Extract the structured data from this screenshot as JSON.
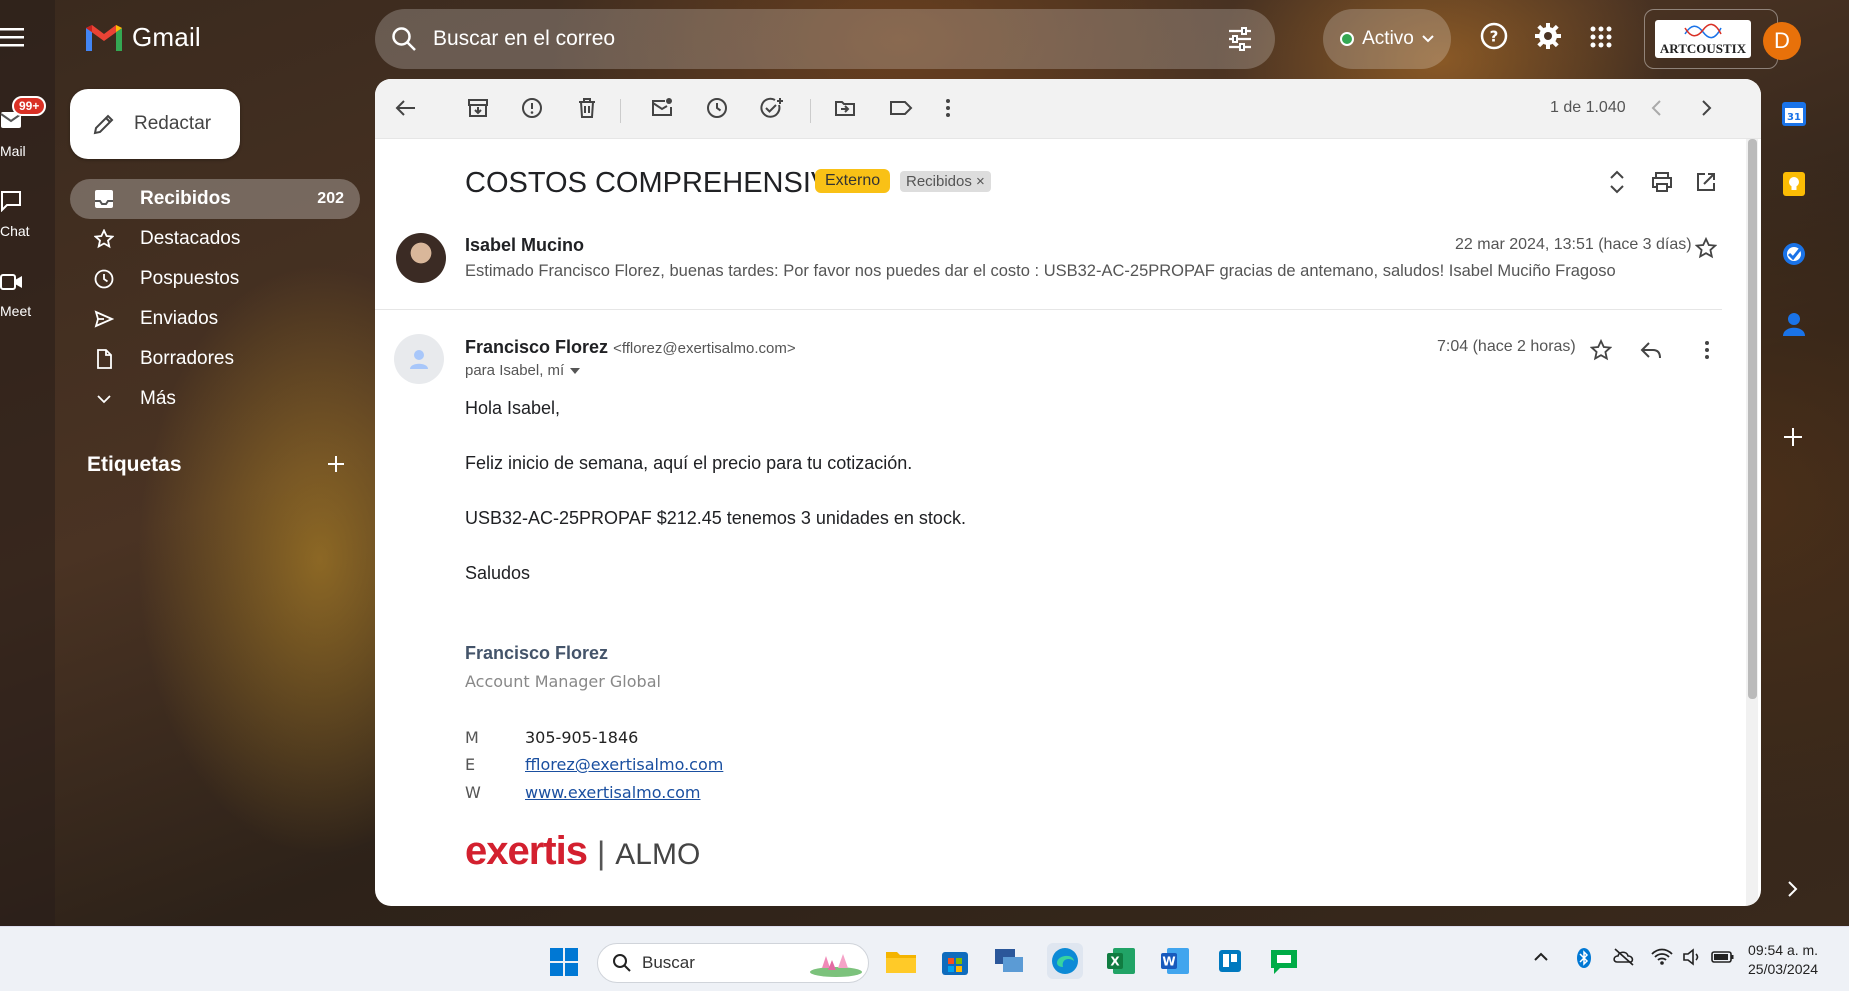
{
  "rail": {
    "mail_badge": "99+",
    "mail_label": "Mail",
    "chat_label": "Chat",
    "meet_label": "Meet"
  },
  "header": {
    "app_name": "Gmail",
    "search_placeholder": "Buscar en el correo",
    "status_label": "Activo",
    "account_logo_text": "ARTCOUSTIX",
    "account_initial": "D"
  },
  "compose": {
    "label": "Redactar"
  },
  "nav": {
    "items": [
      {
        "label": "Recibidos",
        "count": "202"
      },
      {
        "label": "Destacados"
      },
      {
        "label": "Pospuestos"
      },
      {
        "label": "Enviados"
      },
      {
        "label": "Borradores"
      },
      {
        "label": "Más"
      }
    ],
    "labels_title": "Etiquetas"
  },
  "toolbar": {
    "pager": "1 de 1.040"
  },
  "thread": {
    "subject": "COSTOS COMPREHENSIVE",
    "tag_external": "Externo",
    "tag_inbox": "Recibidos",
    "tag_inbox_close": "×",
    "message1": {
      "sender": "Isabel Mucino",
      "date": "22 mar 2024, 13:51 (hace 3 días)",
      "snippet": "Estimado Francisco Florez, buenas tardes: Por favor nos puedes dar el costo : USB32-AC-25PROPAF gracias de antemano, saludos! Isabel Muciño Fragoso compras@artc"
    },
    "message2": {
      "sender": "Francisco Florez",
      "email": "<fflorez@exertisalmo.com>",
      "date": "7:04 (hace 2 horas)",
      "recipients": "para Isabel, mí",
      "body": [
        "Hola Isabel,",
        "Feliz inicio de semana, aquí el precio para tu cotización.",
        "USB32-AC-25PROPAF $212.45 tenemos 3 unidades en stock.",
        "Saludos"
      ],
      "signature": {
        "name": "Francisco Florez",
        "title": "Account Manager Global",
        "mobile_key": "M",
        "mobile": "305-905-1846",
        "email_key": "E",
        "email": "fflorez@exertisalmo.com",
        "web_key": "W",
        "web": "www.exertisalmo.com",
        "brand_left": "exertis",
        "brand_sep": "|",
        "brand_right": "ALMO"
      }
    }
  },
  "taskbar": {
    "search_label": "Buscar",
    "time": "09:54 a. m.",
    "date": "25/03/2024"
  },
  "colors": {
    "accent_red": "#d93025",
    "external_tag": "#f9c116",
    "link": "#1a4fa0",
    "brand_red": "#d3202f"
  }
}
